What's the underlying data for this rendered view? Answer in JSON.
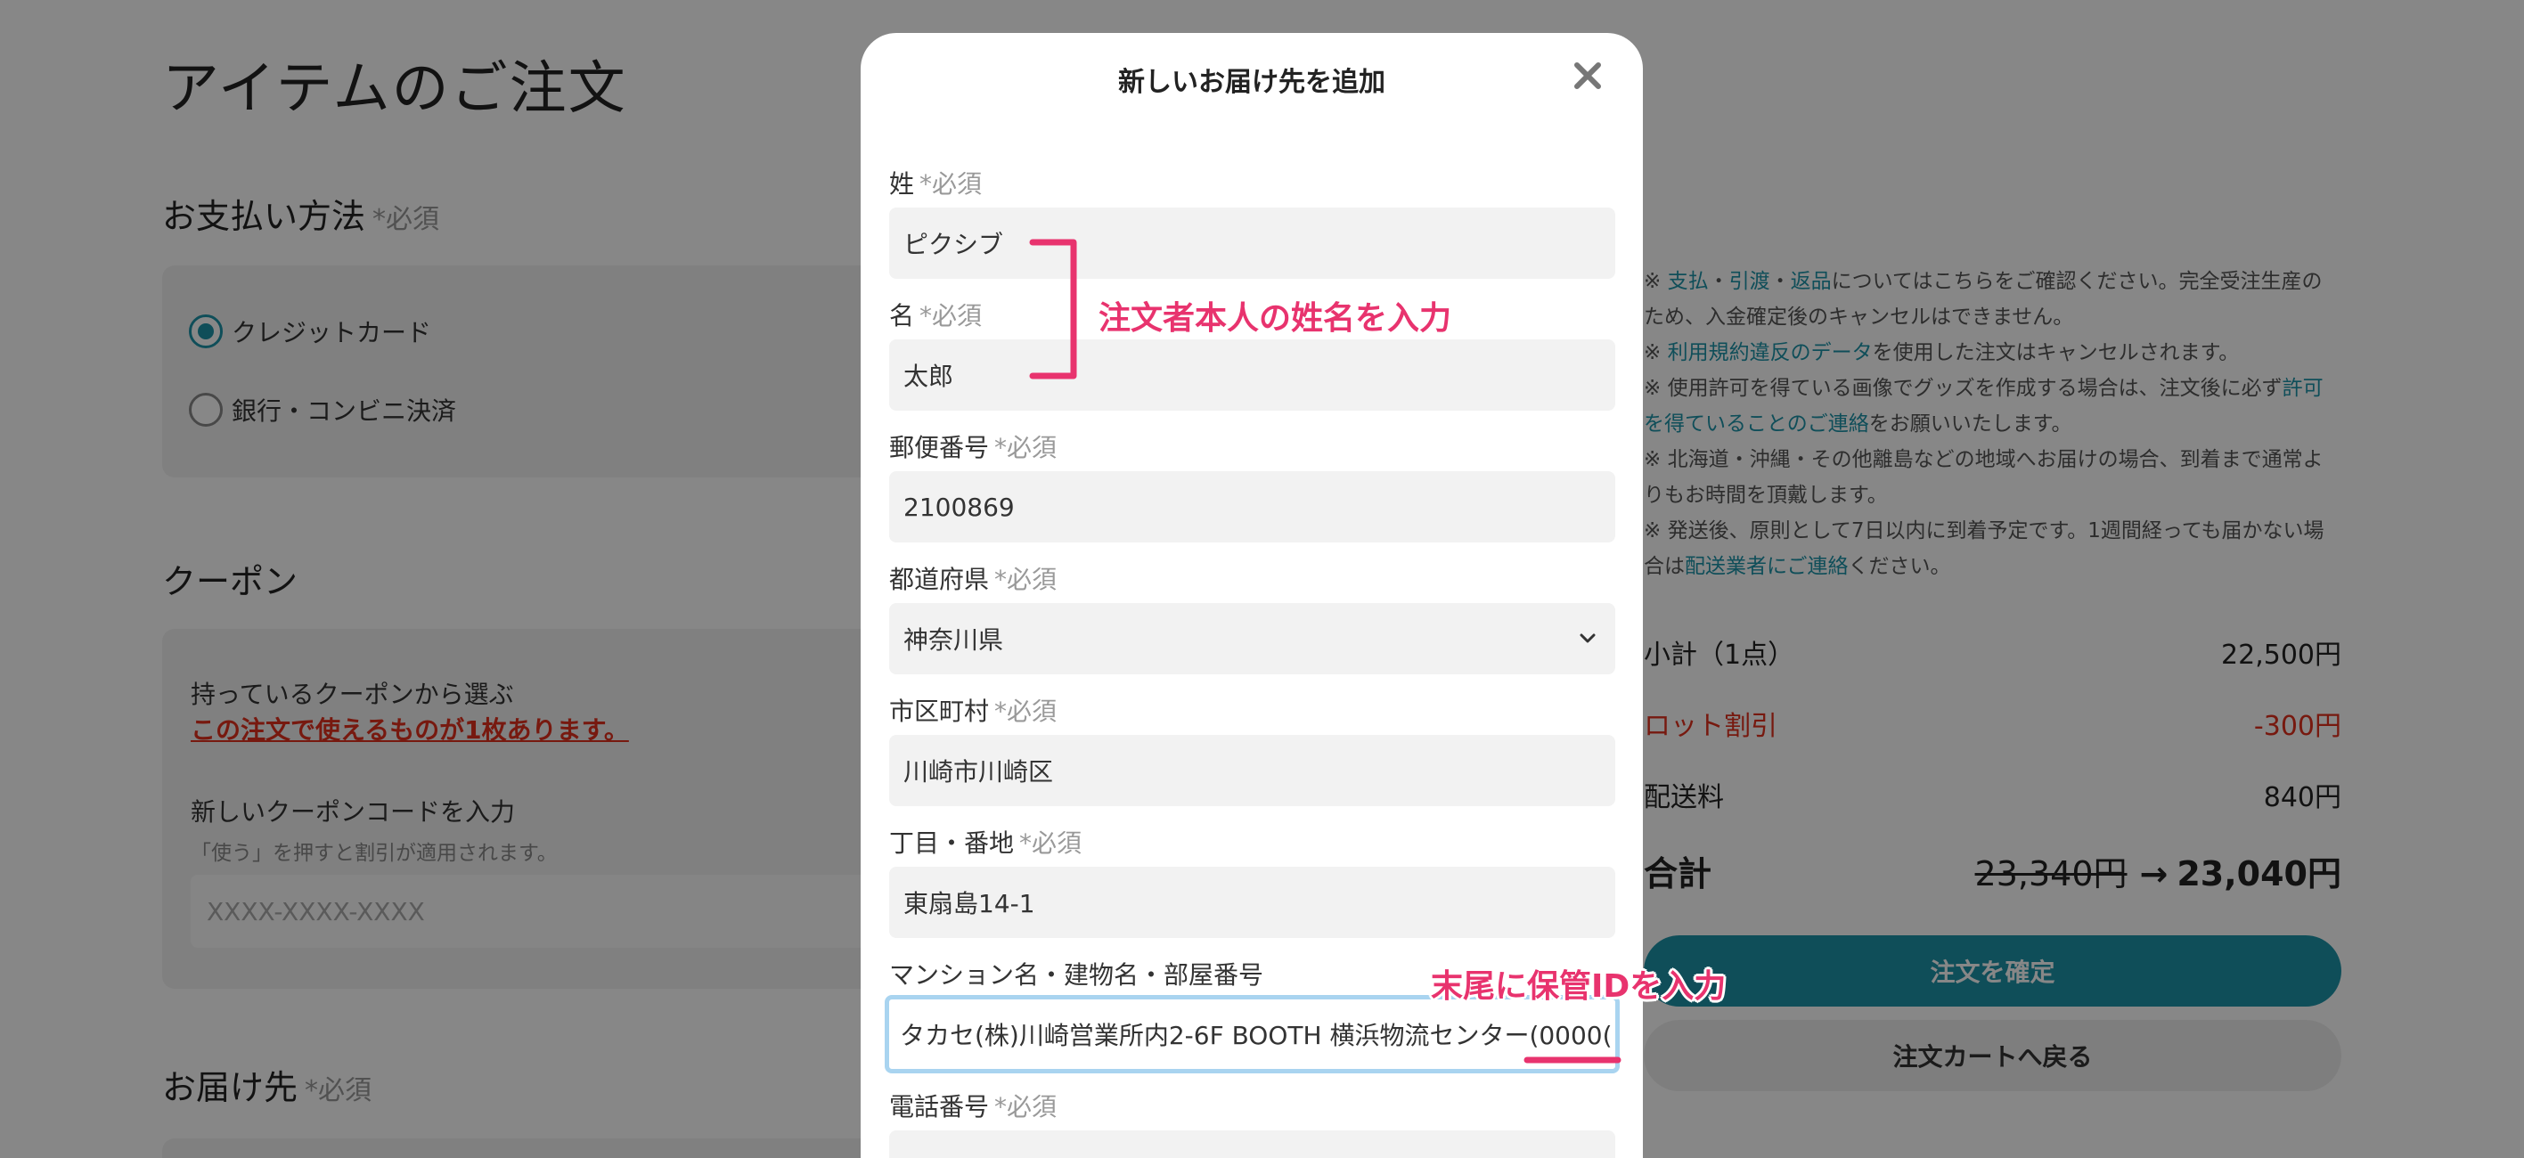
{
  "page": {
    "title": "アイテムのご注文",
    "payment": {
      "title": "お支払い方法",
      "required": "*必須",
      "options": [
        {
          "label": "クレジットカード",
          "selected": true
        },
        {
          "label": "銀行・コンビニ決済",
          "selected": false
        }
      ]
    },
    "coupon": {
      "title": "クーポン",
      "choose_label": "持っているクーポンから選ぶ",
      "available_link": "この注文で使えるものが1枚あります。",
      "new_code_label": "新しいクーポンコードを入力",
      "new_code_note": "「使う」を押すと割引が適用されます。",
      "code_placeholder": "XXXX-XXXX-XXXX"
    },
    "delivery": {
      "title": "お届け先",
      "required": "*必須"
    },
    "notes": [
      [
        "※ ",
        "支払",
        "・",
        "引渡",
        "・",
        "返品",
        "についてはこちらをご確認ください。完全受注生産のため、入金確定後のキャンセルはできません。"
      ],
      [
        "※ ",
        "利用規約違反のデータ",
        "を使用した注文はキャンセルされます。"
      ],
      [
        "※ 使用許可を得ている画像でグッズを作成する場合は、注文後に必ず",
        "許可を得ていることのご連絡",
        "をお願いいたします。"
      ],
      [
        "※ 北海道・沖縄・その他離島などの地域へお届けの場合、到着まで通常よりもお時間を頂戴します。"
      ],
      [
        "※ 発送後、原則として7日以内に到着予定です。1週間経っても届かない場合は",
        "配送業者にご連絡",
        "ください。"
      ]
    ],
    "summary": {
      "subtotal_label": "小計（1点）",
      "subtotal_value": "22,500円",
      "lot_discount_label": "ロット割引",
      "lot_discount_value": "-300円",
      "shipping_label": "配送料",
      "shipping_value": "840円",
      "total_label": "合計",
      "total_old": "23,340円",
      "total_arrow": "→",
      "total_new": "23,040円"
    },
    "buttons": {
      "confirm": "注文を確定",
      "back": "注文カートへ戻る"
    }
  },
  "modal": {
    "title": "新しいお届け先を追加",
    "required": "*必須",
    "fields": {
      "last_name": {
        "label": "姓",
        "value": "ピクシブ"
      },
      "first_name": {
        "label": "名",
        "value": "太郎"
      },
      "postal_code": {
        "label": "郵便番号",
        "value": "2100869"
      },
      "prefecture": {
        "label": "都道府県",
        "value": "神奈川県"
      },
      "city": {
        "label": "市区町村",
        "value": "川崎市川崎区"
      },
      "street": {
        "label": "丁目・番地",
        "value": "東扇島14-1"
      },
      "building": {
        "label": "マンション名・建物名・部屋番号",
        "value": "タカセ(株)川崎営業所内2-6F BOOTH 横浜物流センター(0000("
      },
      "phone": {
        "label": "電話番号",
        "value": ""
      }
    }
  },
  "annotations": {
    "name_note": "注文者本人の姓名を入力",
    "id_note": "末尾に保管IDを入力"
  },
  "colors": {
    "accent": "#1e93a8",
    "discount": "#e0301e",
    "annotation": "#e8336e",
    "focus_border": "#a9d4f0"
  },
  "icons": {
    "close": "close-icon",
    "select": "chevron-down-icon",
    "radio": "radio-icon"
  }
}
